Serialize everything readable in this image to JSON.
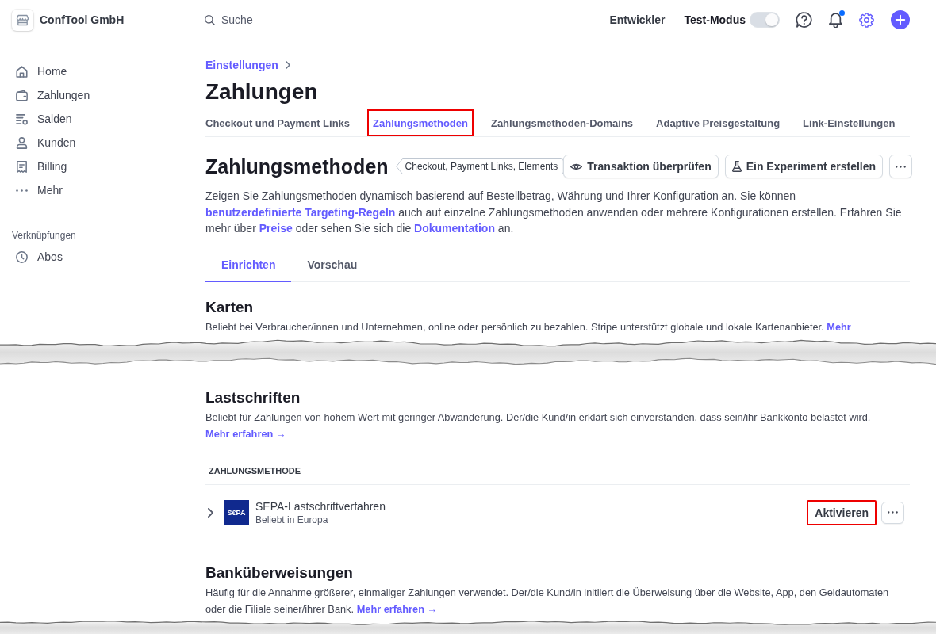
{
  "account": {
    "name": "ConfTool GmbH"
  },
  "search": {
    "placeholder": "Suche"
  },
  "topbar": {
    "developer_link": "Entwickler",
    "test_mode": {
      "label": "Test-Modus",
      "on": true
    },
    "notifications": {
      "unread": true
    }
  },
  "sidebar": {
    "items": [
      {
        "label": "Home",
        "selected": false
      },
      {
        "label": "Zahlungen",
        "selected": false
      },
      {
        "label": "Salden",
        "selected": false
      },
      {
        "label": "Kunden",
        "selected": false
      },
      {
        "label": "Billing",
        "selected": false
      },
      {
        "label": "Mehr",
        "selected": false
      }
    ],
    "shortcuts": {
      "title": "Verknüpfungen",
      "items": [
        {
          "label": "Abos",
          "selected": false
        }
      ]
    }
  },
  "breadcrumb": [
    {
      "label": "Einstellungen"
    }
  ],
  "page_title": "Zahlungen",
  "tabs": [
    {
      "label": "Checkout und Payment Links",
      "selected": false,
      "highlighted": false
    },
    {
      "label": "Zahlungsmethoden",
      "selected": true,
      "highlighted": true
    },
    {
      "label": "Zahlungsmethoden-Domains",
      "selected": false,
      "highlighted": false
    },
    {
      "label": "Adaptive Preisgestaltung",
      "selected": false,
      "highlighted": false
    },
    {
      "label": "Link-Einstellungen",
      "selected": false,
      "highlighted": false
    }
  ],
  "section": {
    "title": "Zahlungsmethoden",
    "tag": "Checkout, Payment Links, Elements",
    "actions": [
      {
        "label": "Transaktion überprüfen"
      },
      {
        "label": "Ein Experiment erstellen"
      }
    ],
    "description": [
      {
        "text": "Zeigen Sie Zahlungsmethoden dynamisch basierend auf Bestellbetrag, Währung und Ihrer Konfiguration an. Sie können "
      },
      {
        "text": "benutzerdefinierte Targeting-Regeln",
        "link": true
      },
      {
        "text": " auch auf einzelne Zahlungsmethoden anwenden oder mehrere Konfigurationen erstellen. Erfahren Sie mehr über "
      },
      {
        "text": "Preise",
        "link": true
      },
      {
        "text": " oder sehen Sie sich die "
      },
      {
        "text": "Dokumentation",
        "link": true
      },
      {
        "text": " an."
      }
    ]
  },
  "subtabs": [
    {
      "label": "Einrichten",
      "selected": true
    },
    {
      "label": "Vorschau",
      "selected": false
    }
  ],
  "groups": [
    {
      "title": "Karten",
      "description": [
        {
          "text": "Beliebt bei Verbraucher/innen und Unternehmen, online oder persönlich zu bezahlen. Stripe unterstützt globale und lokale Kartenanbieter. "
        },
        {
          "text": "Mehr",
          "link": true
        }
      ],
      "torn_after": true
    },
    {
      "title": "Lastschriften",
      "description": [
        {
          "text": "Beliebt für Zahlungen von hohem Wert mit geringer Abwanderung. Der/die Kund/in erklärt sich einverstanden, dass sein/ihr Bankkonto belastet wird. "
        },
        {
          "text": "Mehr erfahren →",
          "link": true
        }
      ],
      "table": {
        "columns": [
          "ZAHLUNGSMETHODE"
        ],
        "rows": [
          {
            "logo": "S€PA",
            "name": "SEPA-Lastschriftverfahren",
            "subtitle": "Beliebt in Europa",
            "expanded": false,
            "action": {
              "label": "Aktivieren",
              "highlighted": true
            }
          }
        ]
      }
    },
    {
      "title": "Banküberweisungen",
      "description": [
        {
          "text": "Häufig für die Annahme größerer, einmaliger Zahlungen verwendet. Der/die Kund/in initiiert die Überweisung über die Website, App, den Geldautomaten oder die Filiale seiner/ihrer Bank. "
        },
        {
          "text": "Mehr erfahren →",
          "link": true
        }
      ],
      "torn_after": true
    }
  ]
}
